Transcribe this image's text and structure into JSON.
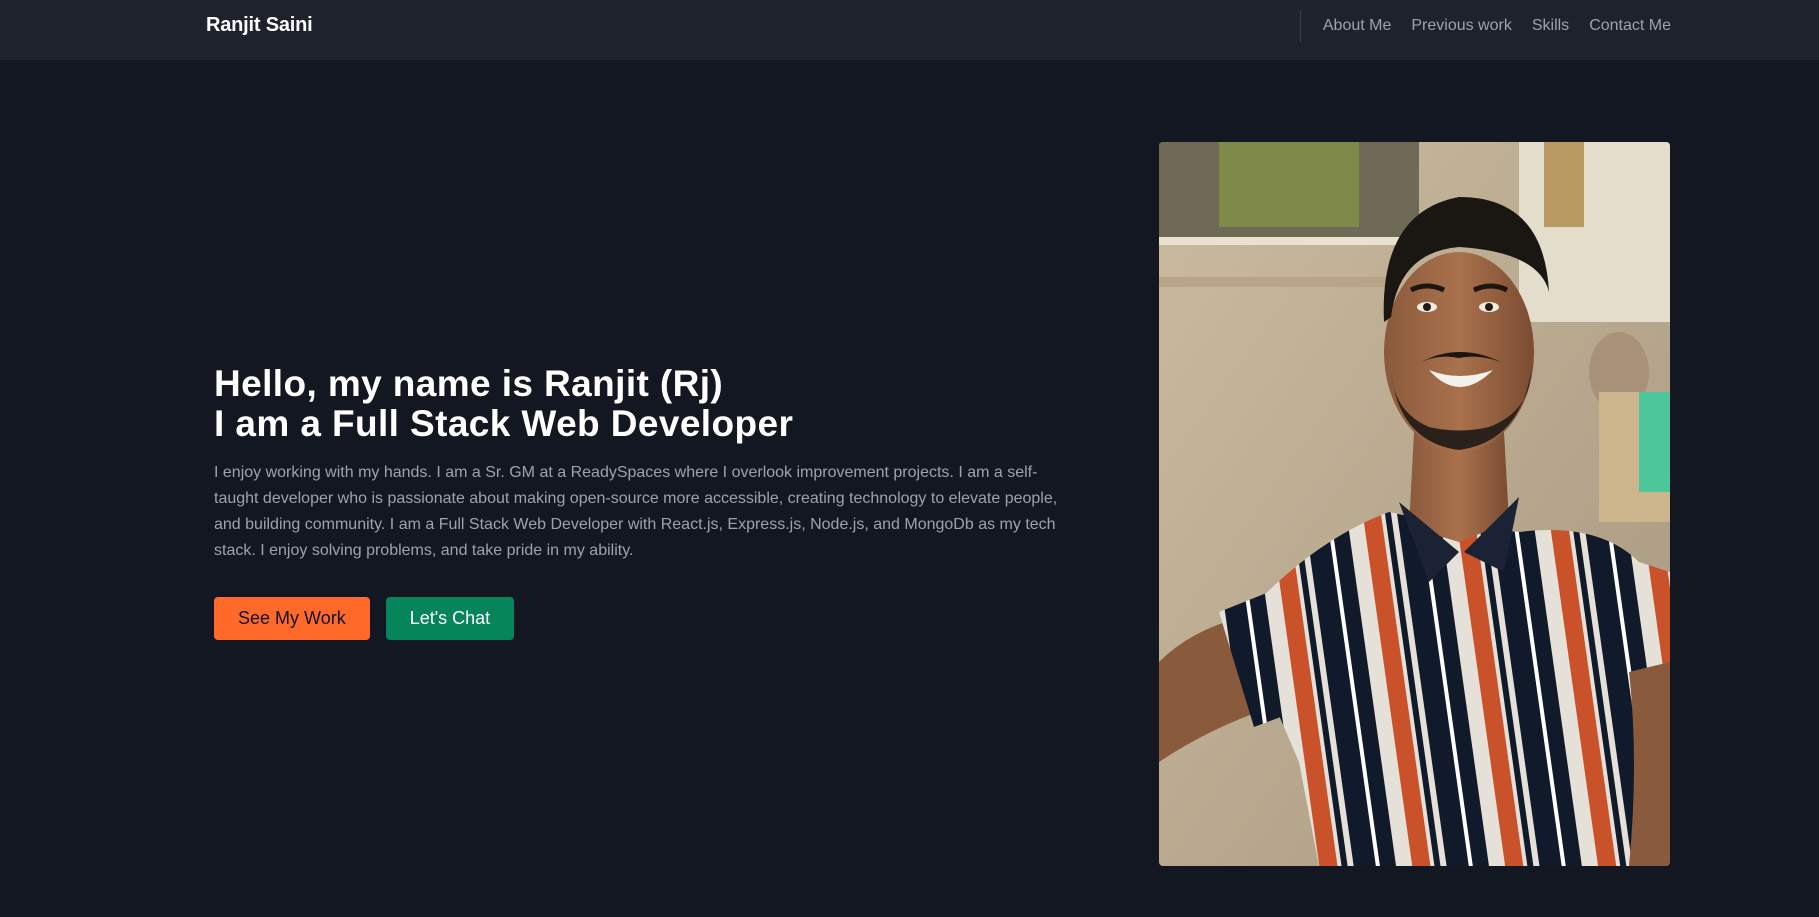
{
  "navbar": {
    "brand": "Ranjit Saini",
    "links": [
      {
        "label": "About Me"
      },
      {
        "label": "Previous work"
      },
      {
        "label": "Skills"
      },
      {
        "label": "Contact Me"
      }
    ]
  },
  "hero": {
    "title_line1": "Hello, my name is Ranjit (Rj)",
    "title_line2": "I am a Full Stack Web Developer",
    "description": "I enjoy working with my hands. I am a Sr. GM at a ReadySpaces where I overlook improvement projects. I am a self-taught developer who is passionate about making open-source more accessible, creating technology to elevate people, and building community. I am a Full Stack Web Developer with React.js, Express.js, Node.js, and MongoDb as my tech stack. I enjoy solving problems, and take pride in my ability.",
    "primary_button": "See My Work",
    "secondary_button": "Let's Chat"
  },
  "colors": {
    "background": "#131722",
    "navbar": "#1d222d",
    "primary_button": "#ff6a2b",
    "secondary_button": "#07855a"
  }
}
